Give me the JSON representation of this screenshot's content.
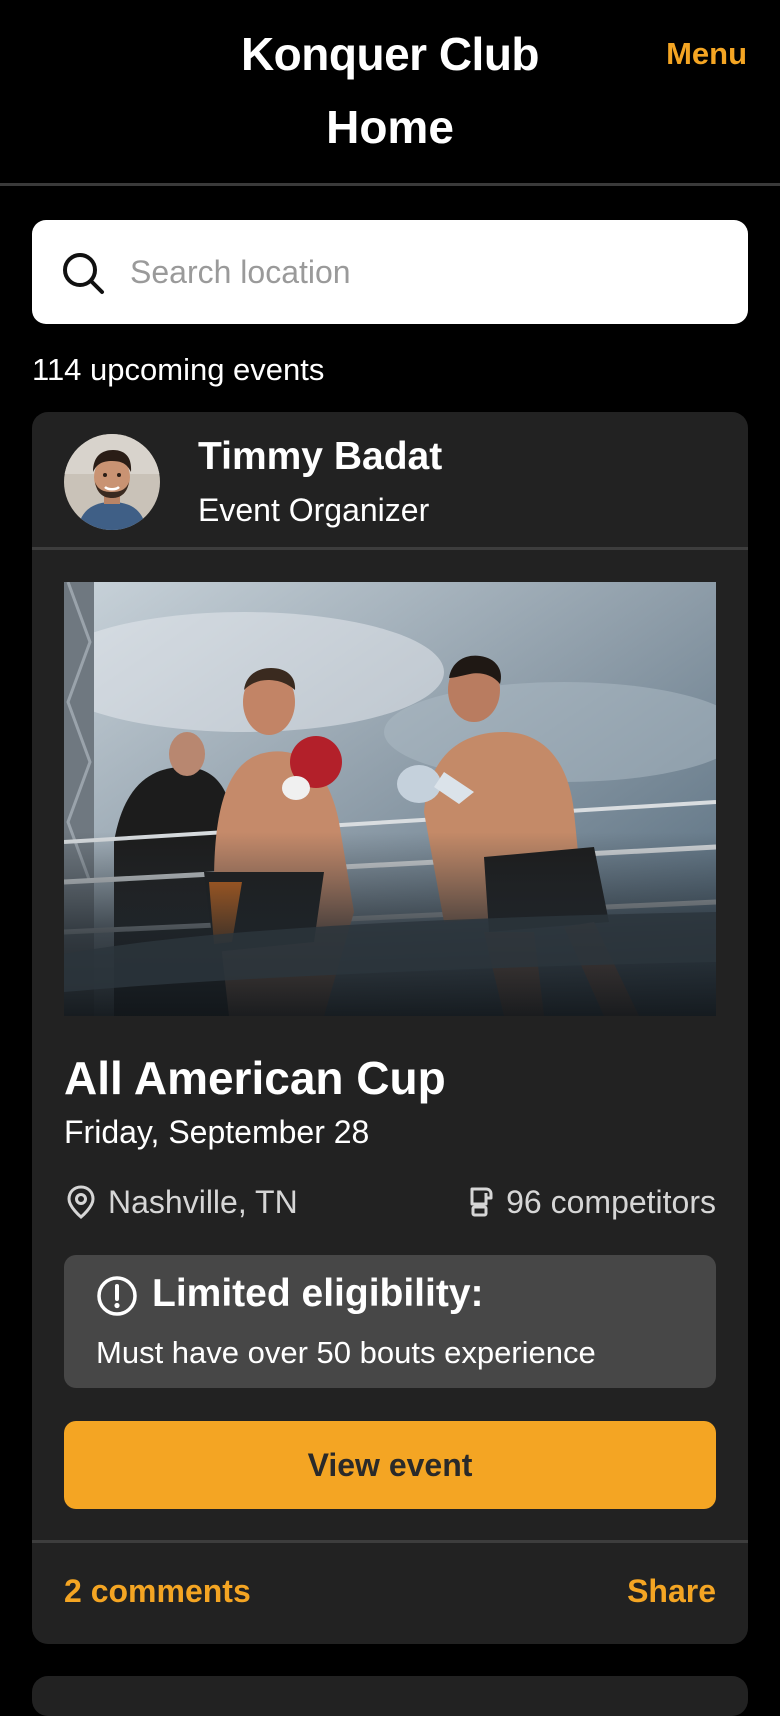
{
  "header": {
    "app_title": "Konquer Club",
    "page_title": "Home",
    "menu_label": "Menu"
  },
  "search": {
    "placeholder": "Search location",
    "value": "",
    "icon": "search-icon"
  },
  "events_count_text": "114 upcoming events",
  "event_card": {
    "organizer": {
      "name": "Timmy Badat",
      "role": "Event Organizer"
    },
    "image_subject": "boxing-match-photo",
    "title": "All American Cup",
    "date": "Friday, September 28",
    "location": "Nashville, TN",
    "competitors": "96 competitors",
    "notice": {
      "title": "Limited eligibility:",
      "text": "Must have over 50 bouts experience",
      "icon": "alert-circle-icon"
    },
    "button_label": "View event",
    "comments_label": "2 comments",
    "share_label": "Share"
  },
  "colors": {
    "background": "#000000",
    "card": "#222222",
    "accent": "#f4a523",
    "notice_bg": "#474747"
  }
}
